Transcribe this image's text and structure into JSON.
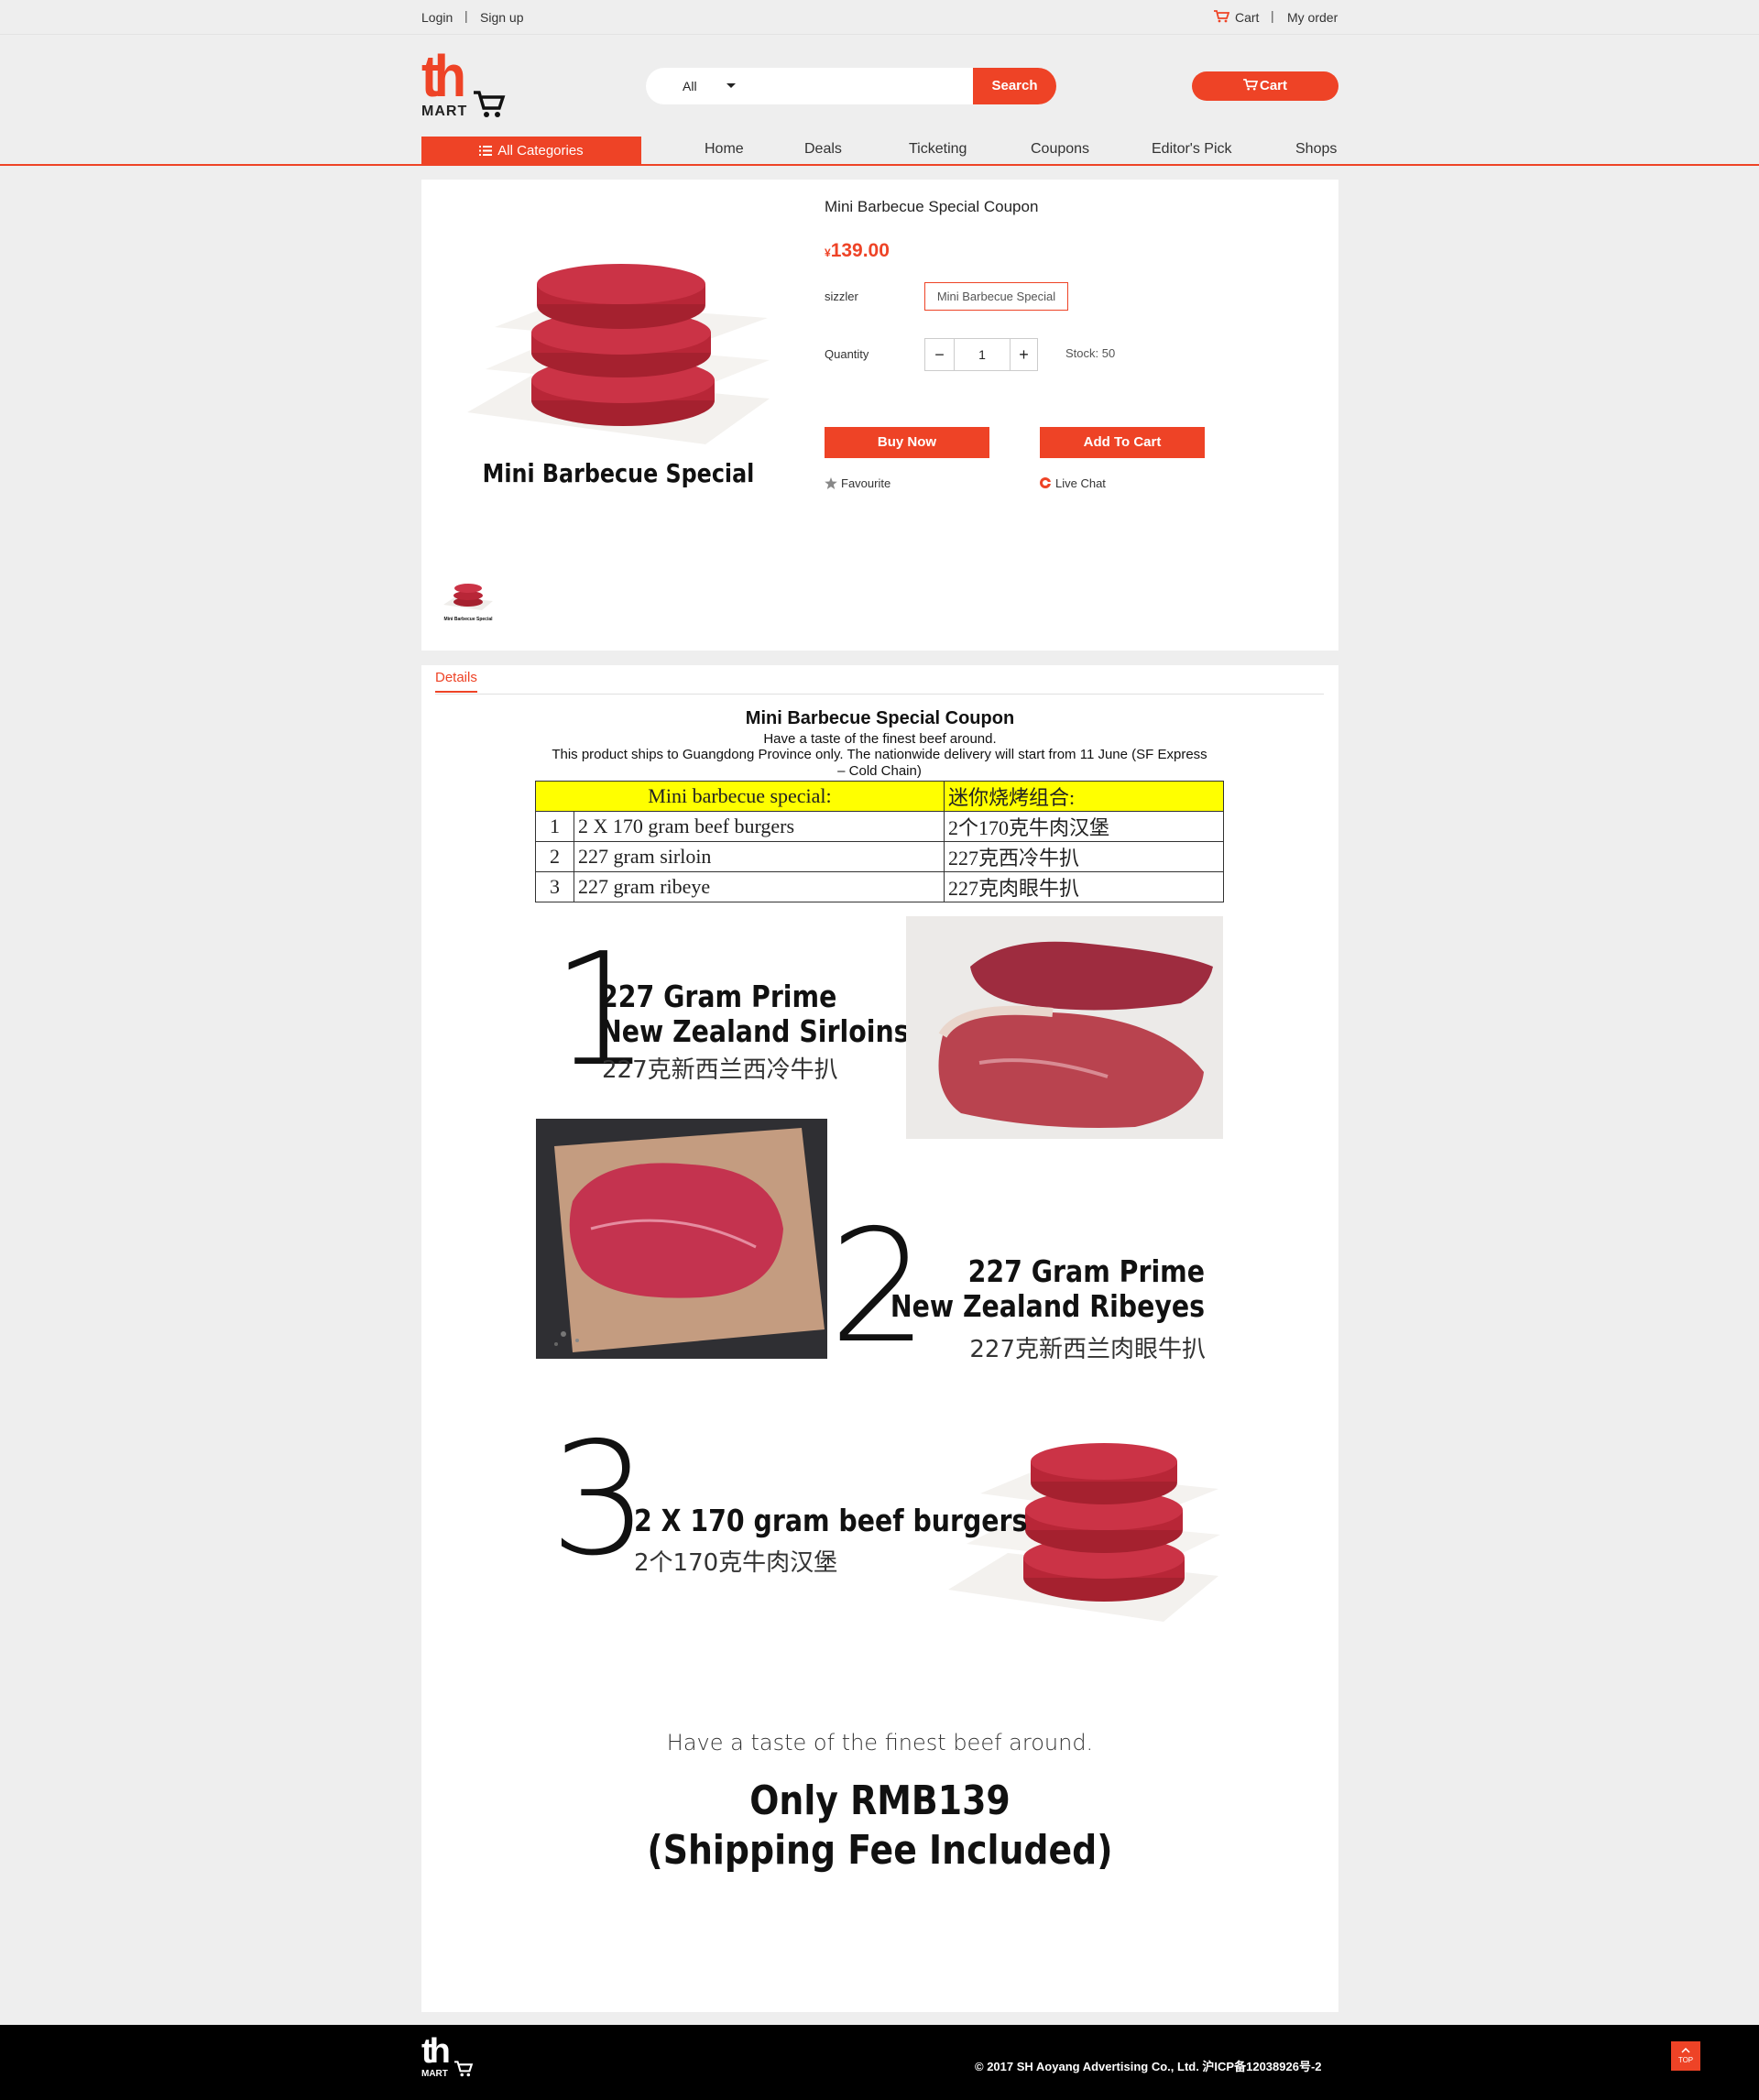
{
  "topbar": {
    "login": "Login",
    "separator": "|",
    "signup": "Sign up",
    "cart": "Cart",
    "my_order": "My order"
  },
  "header": {
    "logo_th": "th",
    "logo_mart": "MART",
    "search_category": "All",
    "search_placeholder": "",
    "search_button": "Search",
    "cart_button": "Cart"
  },
  "nav": {
    "all_categories": "All Categories",
    "items": [
      "Home",
      "Deals",
      "Ticketing",
      "Coupons",
      "Editor's Pick",
      "Shops"
    ]
  },
  "product": {
    "image_caption": "Mini Barbecue Special",
    "title": "Mini Barbecue Special Coupon",
    "currency": "¥",
    "price": "139.00",
    "variant_label": "sizzler",
    "variant_value": "Mini Barbecue Special",
    "quantity_label": "Quantity",
    "quantity_minus": "−",
    "quantity": "1",
    "quantity_plus": "+",
    "stock": "Stock: 50",
    "buy_now": "Buy Now",
    "add_to_cart": "Add To Cart",
    "favourite": "Favourite",
    "live_chat": "Live Chat",
    "thumb_caption": "Mini Barbecue Special"
  },
  "details": {
    "tab": "Details",
    "title": "Mini Barbecue Special Coupon",
    "subtitle": "Have a taste of the finest beef around.",
    "shipping_note": "This product ships to Guangdong Province only. The nationwide delivery will start from 11 June (SF Express – Cold Chain)",
    "table": {
      "header_en": "Mini barbecue special:",
      "header_cn": "迷你烧烤组合:",
      "rows": [
        {
          "num": "1",
          "en": "2 X 170 gram beef burgers",
          "cn": "2个170克牛肉汉堡"
        },
        {
          "num": "2",
          "en": "227 gram sirloin",
          "cn": "227克西冷牛扒"
        },
        {
          "num": "3",
          "en": "227 gram ribeye",
          "cn": "227克肉眼牛扒"
        }
      ]
    },
    "item1": {
      "num": "1",
      "line1": "227 Gram Prime",
      "line2": "New Zealand Sirloins",
      "cn": "227克新西兰西冷牛扒"
    },
    "item2": {
      "num": "2",
      "line1": "227 Gram Prime",
      "line2": "New Zealand Ribeyes",
      "cn": "227克新西兰肉眼牛扒"
    },
    "item3": {
      "num": "3",
      "line1": "2 X 170 gram beef burgers",
      "cn": "2个170克牛肉汉堡"
    },
    "tagline": "Have a taste of the finest beef around.",
    "offer_line1": "Only RMB139",
    "offer_line2": "(Shipping Fee Included)"
  },
  "footer": {
    "logo_th": "th",
    "logo_mart": "MART",
    "copyright": "© 2017 SH Aoyang Advertising Co., Ltd. 沪ICP备12038926号-2",
    "top_button": "TOP"
  },
  "colors": {
    "accent": "#ee4326",
    "table_header": "#ffff00",
    "footer": "#000000",
    "page_bg": "#eeeeee"
  }
}
